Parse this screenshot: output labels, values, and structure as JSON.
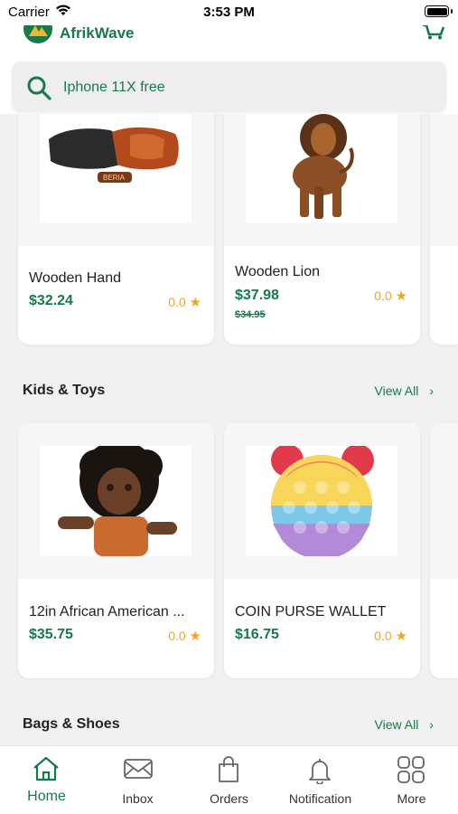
{
  "status": {
    "carrier": "Carrier",
    "time": "3:53 PM"
  },
  "header": {
    "app_name": "AfrikWave"
  },
  "search": {
    "text": "Iphone 11X free"
  },
  "products_row1": [
    {
      "name": "Wooden Hand",
      "price": "$32.24",
      "old_price": "",
      "rating": "0.0"
    },
    {
      "name": "Wooden Lion",
      "price": "$37.98",
      "old_price": "$34.95",
      "rating": "0.0"
    }
  ],
  "sections": {
    "kids_toys": {
      "title": "Kids & Toys",
      "view_all": "View All"
    },
    "bags_shoes": {
      "title": "Bags & Shoes",
      "view_all": "View All"
    }
  },
  "products_kids": [
    {
      "name": "12in African American ...",
      "price": "$35.75",
      "rating": "0.0"
    },
    {
      "name": "COIN PURSE WALLET",
      "price": "$16.75",
      "rating": "0.0"
    }
  ],
  "nav": {
    "items": [
      {
        "label": "Home",
        "icon": "home-icon",
        "active": true
      },
      {
        "label": "Inbox",
        "icon": "mail-icon",
        "active": false
      },
      {
        "label": "Orders",
        "icon": "shopping-bag-icon",
        "active": false
      },
      {
        "label": "Notification",
        "icon": "bell-icon",
        "active": false
      },
      {
        "label": "More",
        "icon": "grid-icon",
        "active": false
      }
    ]
  },
  "colors": {
    "brand": "#167a4a",
    "rating": "#f0a623",
    "background": "#f1f1f1"
  }
}
